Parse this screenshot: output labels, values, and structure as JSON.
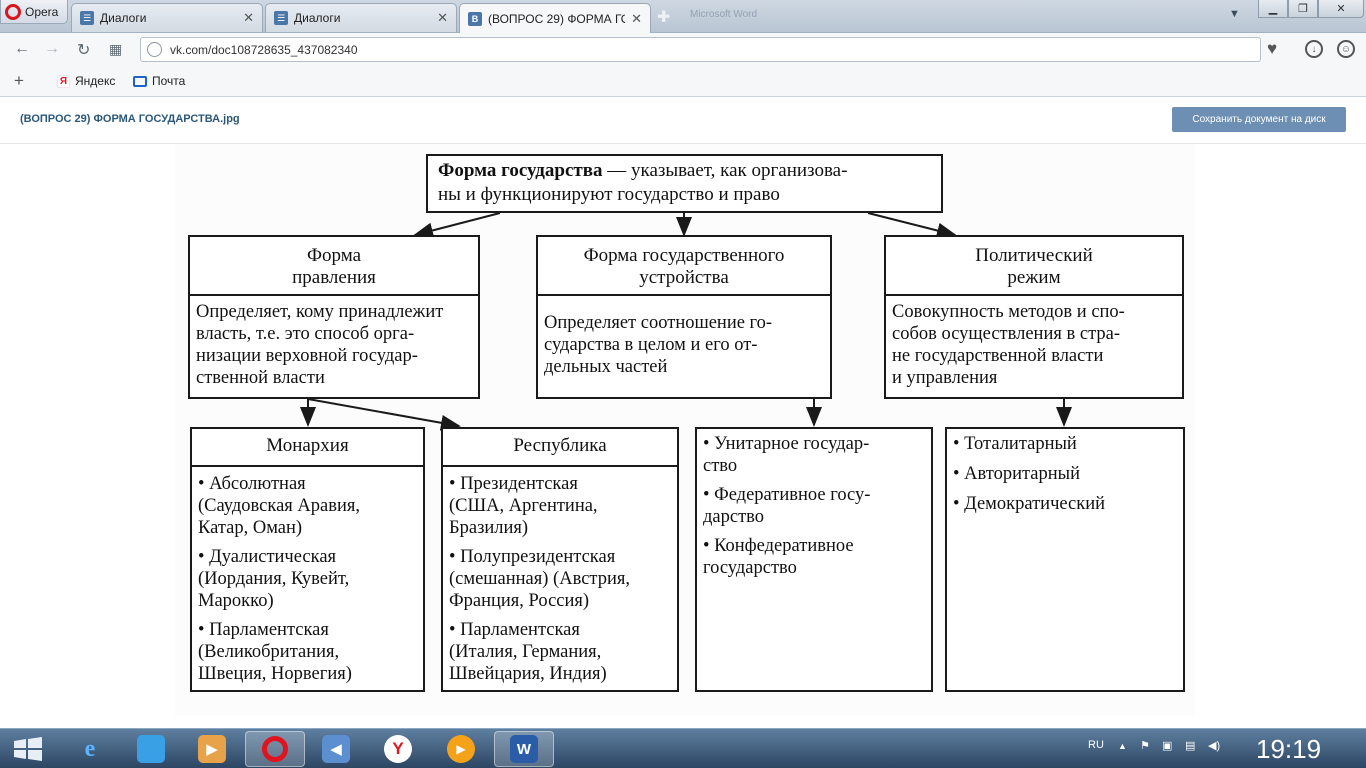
{
  "browser": {
    "menu_label": "Opera",
    "tabs": [
      {
        "title": "Диалоги",
        "favicon": "vk-icon"
      },
      {
        "title": "Диалоги",
        "favicon": "vk-icon"
      },
      {
        "title": "(ВОПРОС 29) ФОРМА ГОС",
        "favicon": "vk-icon"
      }
    ],
    "faded_window_title": "Microsoft Word",
    "url": "vk.com/doc108728635_437082340",
    "bookmarks": [
      "Яндекс",
      "Почта"
    ]
  },
  "page": {
    "document_title": "(ВОПРОС 29) ФОРМА ГОСУДАРСТВА.jpg",
    "save_button": "Сохранить документ на диск"
  },
  "diagram": {
    "root": {
      "line1_bold": "Форма государства",
      "line1_rest": " — указывает, как организова-",
      "line2": "ны и функционируют государство и право"
    },
    "columns": [
      {
        "title_line1": "Форма",
        "title_line2": "правления",
        "body": [
          "Определяет, кому принадлежит",
          "власть, т.е. это способ орга-",
          "низации верховной государ-",
          "ственной власти"
        ]
      },
      {
        "title_line1": "Форма государственного",
        "title_line2": "устройства",
        "body": [
          "Определяет соотношение го-",
          "сударства в целом и его от-",
          "дельных частей"
        ]
      },
      {
        "title_line1": "Политический",
        "title_line2": "режим",
        "body": [
          "Совокупность методов и спо-",
          "собов осуществления в стра-",
          "не государственной власти",
          "и управления"
        ]
      }
    ],
    "monarchy": {
      "title": "Монархия",
      "items": [
        [
          "• Абсолютная",
          "(Саудовская Аравия,",
          "Катар, Оман)"
        ],
        [
          "• Дуалистическая",
          "(Иордания, Кувейт,",
          "Марокко)"
        ],
        [
          "• Парламентская",
          "(Великобритания,",
          "Швеция, Норвегия)"
        ]
      ]
    },
    "republic": {
      "title": "Республика",
      "items": [
        [
          "• Президентская",
          "(США, Аргентина,",
          "Бразилия)"
        ],
        [
          "• Полупрезидентская",
          "(смешанная) (Австрия,",
          "Франция, Россия)"
        ],
        [
          "• Парламентская",
          "(Италия, Германия,",
          "Швейцария, Индия)"
        ]
      ]
    },
    "structure_types": [
      [
        "• Унитарное государ-",
        "ство"
      ],
      [
        "• Федеративное госу-",
        "дарство"
      ],
      [
        "• Конфедеративное",
        "государство"
      ]
    ],
    "regime_types": [
      "• Тоталитарный",
      "• Авторитарный",
      "• Демократический"
    ]
  },
  "taskbar": {
    "language": "RU",
    "clock": "19:19"
  }
}
